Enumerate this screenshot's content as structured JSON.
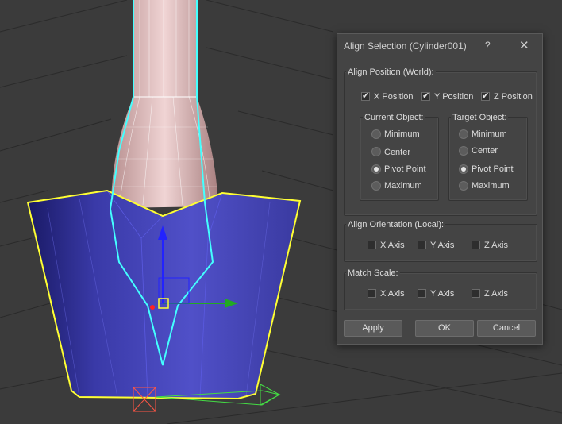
{
  "scene": {
    "object_colors": {
      "mesh_fill": "#4a4ab8",
      "selection_outline": "#ffff33",
      "target_outline": "#44ffff",
      "stem_fill": "#d8b4b4"
    }
  },
  "dialog": {
    "title": "Align Selection (Cylinder001)",
    "help_label": "?",
    "close_label": "✕",
    "align_position": {
      "label": "Align Position (World):",
      "x": {
        "label": "X Position",
        "checked": true
      },
      "y": {
        "label": "Y Position",
        "checked": true
      },
      "z": {
        "label": "Z Position",
        "checked": true
      }
    },
    "current_object": {
      "label": "Current Object:",
      "options": [
        "Minimum",
        "Center",
        "Pivot Point",
        "Maximum"
      ],
      "selected": "Pivot Point"
    },
    "target_object": {
      "label": "Target Object:",
      "options": [
        "Minimum",
        "Center",
        "Pivot Point",
        "Maximum"
      ],
      "selected": "Pivot Point"
    },
    "align_orientation": {
      "label": "Align Orientation (Local):",
      "x": {
        "label": "X Axis",
        "checked": false
      },
      "y": {
        "label": "Y Axis",
        "checked": false
      },
      "z": {
        "label": "Z Axis",
        "checked": false
      }
    },
    "match_scale": {
      "label": "Match Scale:",
      "x": {
        "label": "X Axis",
        "checked": false
      },
      "y": {
        "label": "Y Axis",
        "checked": false
      },
      "z": {
        "label": "Z Axis",
        "checked": false
      }
    },
    "buttons": {
      "apply": "Apply",
      "ok": "OK",
      "cancel": "Cancel"
    }
  }
}
